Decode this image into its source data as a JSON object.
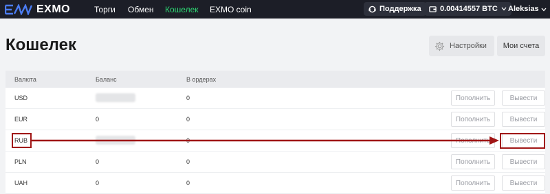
{
  "header": {
    "brand": "EXMO",
    "nav": [
      "Торги",
      "Обмен",
      "Кошелек",
      "EXMO coin"
    ],
    "support_label": "Поддержка",
    "balance_label": "0.00414557 BTC",
    "user_name": "Aleksias",
    "accent_color": "#2dd673"
  },
  "page": {
    "title": "Кошелек",
    "settings_label": "Настройки",
    "accounts_label": "Мои счета"
  },
  "table": {
    "columns": [
      "Валюта",
      "Баланс",
      "В ордерах"
    ],
    "deposit_label": "Пополнить",
    "withdraw_label": "Вывести",
    "rows": [
      {
        "currency": "USD",
        "balance": "",
        "balance_hidden": true,
        "in_orders": "0"
      },
      {
        "currency": "EUR",
        "balance": "0",
        "balance_hidden": false,
        "in_orders": "0"
      },
      {
        "currency": "RUB",
        "balance": "",
        "balance_hidden": true,
        "in_orders": "0"
      },
      {
        "currency": "PLN",
        "balance": "0",
        "balance_hidden": false,
        "in_orders": "0"
      },
      {
        "currency": "UAH",
        "balance": "0",
        "balance_hidden": false,
        "in_orders": "0"
      }
    ]
  },
  "annotation": {
    "color": "#a01515"
  }
}
